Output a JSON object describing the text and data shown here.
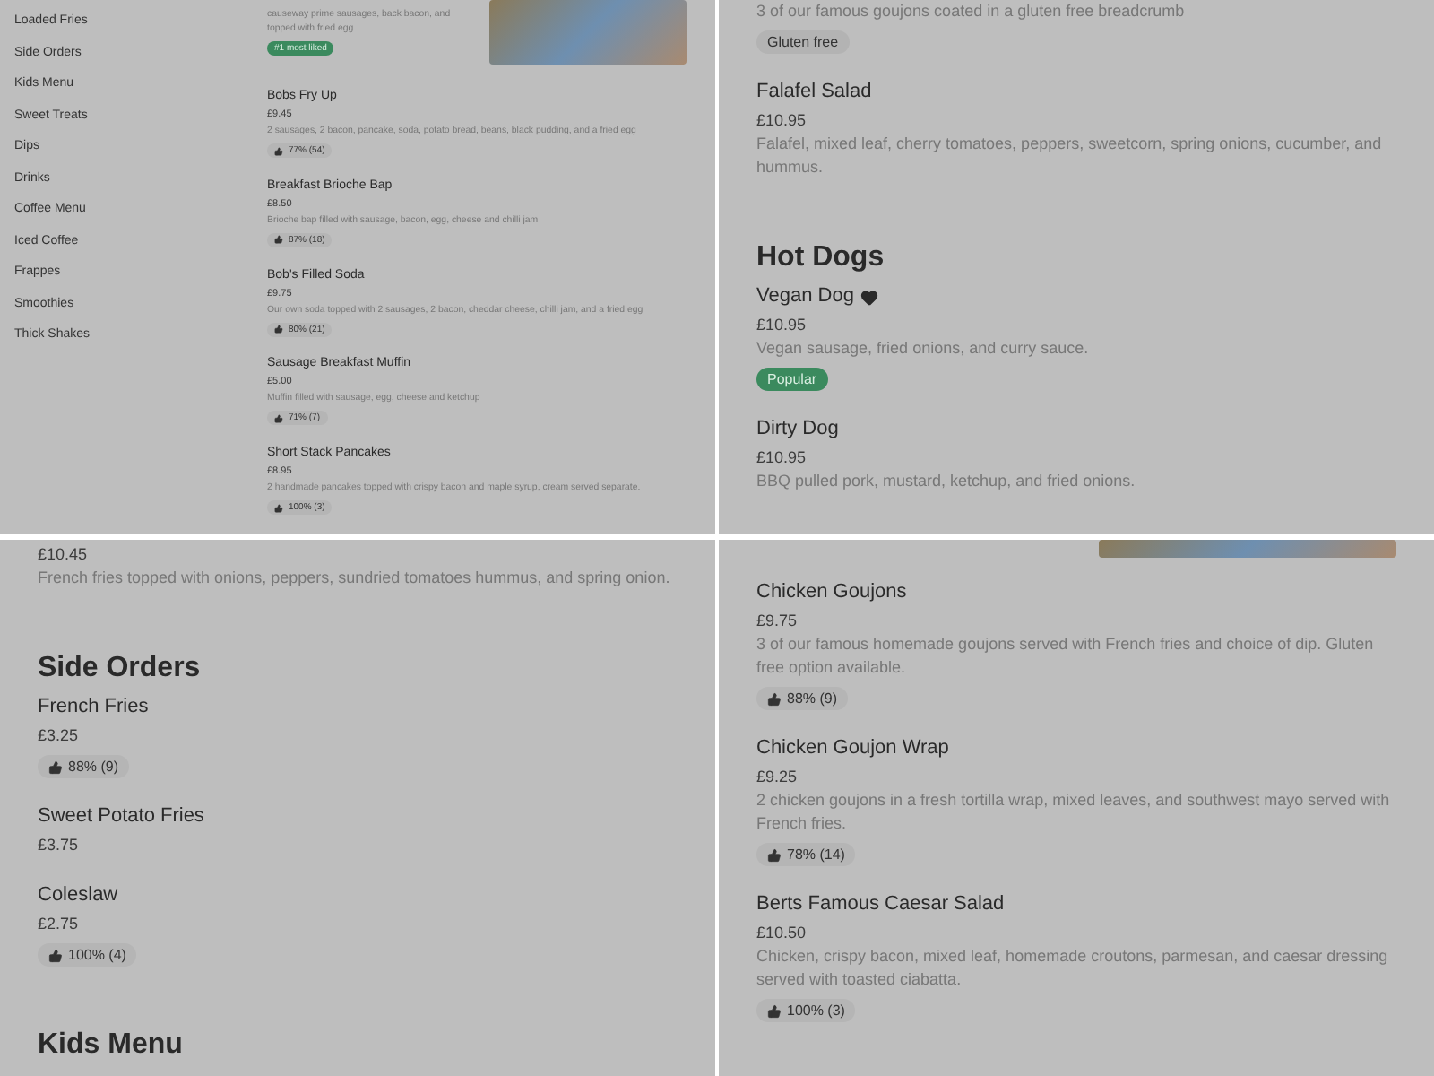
{
  "panels": [
    {
      "kind": "compact",
      "sidebar": {
        "items": [
          {
            "label": "Loaded Fries"
          },
          {
            "label": "Side Orders"
          },
          {
            "label": "Kids Menu"
          },
          {
            "label": "Sweet Treats"
          },
          {
            "label": "Dips"
          },
          {
            "label": "Drinks"
          },
          {
            "label": "Coffee Menu"
          },
          {
            "label": "Iced Coffee"
          },
          {
            "label": "Frappes"
          },
          {
            "label": "Smoothies"
          },
          {
            "label": "Thick Shakes"
          }
        ]
      },
      "entries": [
        {
          "kind": "item",
          "description": "causeway prime sausages, back bacon, and topped with fried egg",
          "tags": [
            {
              "label": "#1 most liked",
              "kind": "highlight"
            }
          ],
          "photo": true
        },
        {
          "kind": "item",
          "name": "Bobs Fry Up",
          "price": "£9.45",
          "description": "2 sausages, 2 bacon, pancake, soda, potato bread, beans, black pudding, and a fried egg",
          "rating": "77% (54)"
        },
        {
          "kind": "item",
          "name": "Breakfast Brioche Bap",
          "price": "£8.50",
          "description": "Brioche bap filled with sausage, bacon, egg, cheese and chilli jam",
          "rating": "87% (18)"
        },
        {
          "kind": "item",
          "name": "Bob's Filled Soda",
          "price": "£9.75",
          "description": "Our own soda topped with 2 sausages, 2 bacon, cheddar cheese, chilli jam, and a fried egg",
          "rating": "80% (21)"
        },
        {
          "kind": "item",
          "name": "Sausage Breakfast Muffin",
          "price": "£5.00",
          "description": "Muffin filled with sausage, egg, cheese and ketchup",
          "rating": "71% (7)"
        },
        {
          "kind": "item",
          "name": "Short Stack Pancakes",
          "price": "£8.95",
          "description": "2 handmade pancakes topped with crispy bacon and maple syrup, cream served separate.",
          "rating": "100% (3)"
        }
      ]
    },
    {
      "kind": "full",
      "entries": [
        {
          "kind": "item",
          "description": "3 of our famous goujons coated in a gluten free breadcrumb",
          "tags": [
            {
              "label": "Gluten free",
              "kind": "plain"
            }
          ]
        },
        {
          "kind": "item",
          "name": "Falafel Salad",
          "price": "£10.95",
          "description": "Falafel, mixed leaf, cherry tomatoes, peppers, sweetcorn, spring onions, cucumber, and hummus."
        },
        {
          "kind": "heading",
          "title": "Hot Dogs"
        },
        {
          "kind": "item",
          "name": "Vegan Dog",
          "vegan": true,
          "price": "£10.95",
          "description": "Vegan sausage, fried onions, and curry sauce.",
          "tags": [
            {
              "label": "Popular",
              "kind": "highlight"
            }
          ]
        },
        {
          "kind": "item",
          "name": "Dirty Dog",
          "price": "£10.95",
          "description": "BBQ pulled pork, mustard, ketchup, and fried onions."
        }
      ]
    },
    {
      "kind": "full",
      "entries": [
        {
          "kind": "item",
          "price": "£10.45",
          "description": "French fries topped with onions, peppers, sundried tomatoes hummus, and spring onion."
        },
        {
          "kind": "heading",
          "title": "Side Orders"
        },
        {
          "kind": "item",
          "name": "French Fries",
          "price": "£3.25",
          "rating": "88% (9)"
        },
        {
          "kind": "item",
          "name": "Sweet Potato Fries",
          "price": "£3.75"
        },
        {
          "kind": "item",
          "name": "Coleslaw",
          "price": "£2.75",
          "rating": "100% (4)"
        },
        {
          "kind": "heading",
          "title": "Kids Menu"
        }
      ]
    },
    {
      "kind": "full",
      "entries": [
        {
          "kind": "photo"
        },
        {
          "kind": "item",
          "name": "Chicken Goujons",
          "price": "£9.75",
          "description": "3 of our famous homemade goujons served with French fries and choice of dip. Gluten free option available.",
          "rating": "88% (9)"
        },
        {
          "kind": "item",
          "name": "Chicken Goujon Wrap",
          "price": "£9.25",
          "description": "2 chicken goujons in a fresh tortilla wrap, mixed leaves, and southwest mayo served with French fries.",
          "rating": "78% (14)"
        },
        {
          "kind": "item",
          "name": "Berts Famous Caesar Salad",
          "price": "£10.50",
          "description": "Chicken, crispy bacon, mixed leaf, homemade croutons, parmesan, and caesar dressing served with toasted ciabatta.",
          "rating": "100% (3)"
        }
      ]
    }
  ]
}
